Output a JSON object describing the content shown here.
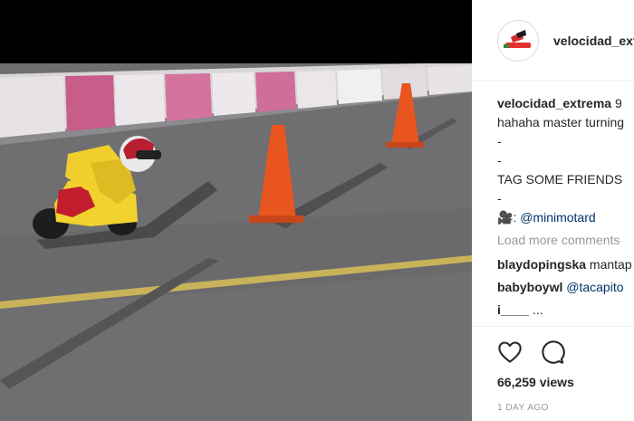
{
  "post": {
    "username": "velocidad_extrema",
    "header_username": "velocidad_extrema",
    "caption_user": "velocidad_extrema",
    "caption_text_1": " 9",
    "caption_text_2": "hahaha master turning",
    "caption_dash_1": "-",
    "caption_dash_2": "-",
    "caption_tag": "TAG SOME FRIENDS",
    "caption_dash_3": "-",
    "mention_emoji": "🎥",
    "mention": ": @minimotard",
    "load_more": "Load more comments",
    "comments": [
      {
        "user": "blaydopingska",
        "text": " mantap"
      },
      {
        "user": "babyboywl",
        "text": " @tacapito"
      },
      {
        "user": "i____",
        "text": " ..."
      }
    ],
    "views": "66,259 views",
    "time": "1 DAY AGO"
  },
  "colors": {
    "text": "#262626",
    "muted": "#999999",
    "link": "#003569",
    "bike": "#f2d22e",
    "cone": "#e8551f"
  },
  "icons": [
    "logo-avatar-icon",
    "heart-icon",
    "comment-bubble-icon"
  ]
}
